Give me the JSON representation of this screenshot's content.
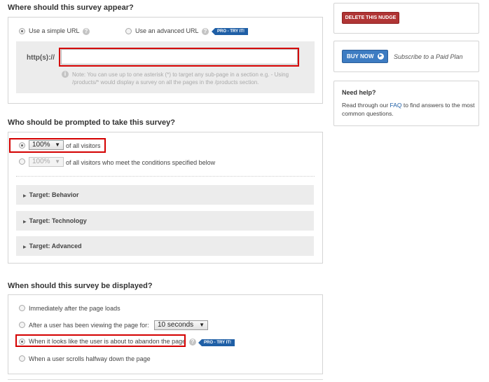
{
  "section1": {
    "title": "Where should this survey appear?",
    "simple_url_label": "Use a simple URL",
    "advanced_url_label": "Use an advanced URL",
    "pro_badge": "PRO - TRY IT!",
    "url_prefix": "http(s)://",
    "url_value": "",
    "note": "Note: You can use up to one asterisk (*) to target any sub-page in a section e.g. - Using /products/* would display a survey on all the pages in the /products section."
  },
  "section2": {
    "title": "Who should be prompted to take this survey?",
    "pct_selected": "100%",
    "all_visitors_label": "of all visitors",
    "pct_disabled": "100%",
    "conditions_label": "of all visitors who meet the conditions specified below",
    "targets": [
      "Target: Behavior",
      "Target: Technology",
      "Target: Advanced"
    ]
  },
  "section3": {
    "title": "When should this survey be displayed?",
    "options": [
      "Immediately after the page loads",
      "After a user has been viewing the page for:",
      "When it looks like the user is about to abandon the page",
      "When a user scrolls halfway down the page"
    ],
    "delay_value": "10 seconds",
    "pro_badge": "PRO - TRY IT!"
  },
  "sidebar": {
    "delete_label": "DELETE THIS NUDGE",
    "buy_now_label": "BUY NOW",
    "subscribe_text": "Subscribe to a Paid Plan",
    "help_title": "Need help?",
    "help_text_before": "Read through our ",
    "help_link": "FAQ",
    "help_text_after": " to find answers to the most common questions."
  },
  "colors": {
    "highlight": "#d40000",
    "pro_badge": "#1f5fa6",
    "delete_button": "#b03535",
    "buy_button": "#3d7cc2"
  }
}
